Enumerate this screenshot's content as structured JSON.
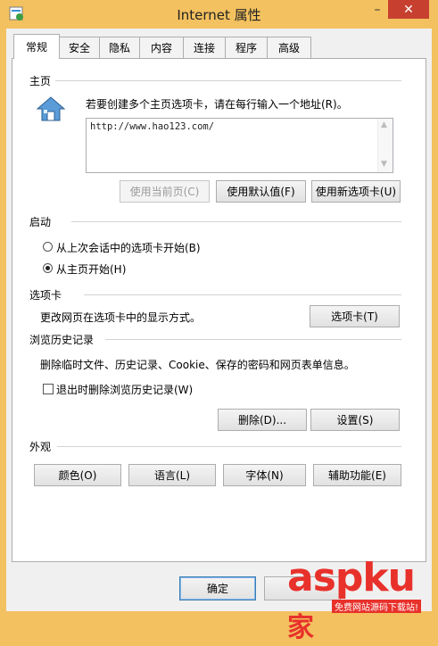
{
  "window": {
    "title": "Internet 属性",
    "minimize_glyph": "–",
    "close_glyph": "✕",
    "accent_color": "#f3c15f",
    "close_color": "#c7402f"
  },
  "tabs": [
    {
      "label": "常规",
      "active": true
    },
    {
      "label": "安全",
      "active": false
    },
    {
      "label": "隐私",
      "active": false
    },
    {
      "label": "内容",
      "active": false
    },
    {
      "label": "连接",
      "active": false
    },
    {
      "label": "程序",
      "active": false
    },
    {
      "label": "高级",
      "active": false
    }
  ],
  "home": {
    "heading": "主页",
    "icon": "house-icon",
    "instruction": "若要创建多个主页选项卡，请在每行输入一个地址(R)。",
    "value": "http://www.hao123.com/",
    "buttons": {
      "use_current": "使用当前页(C)",
      "use_default": "使用默认值(F)",
      "use_new_tab": "使用新选项卡(U)"
    }
  },
  "startup": {
    "heading": "启动",
    "option_last_session": "从上次会话中的选项卡开始(B)",
    "option_home": "从主页开始(H)",
    "selected": "option_home"
  },
  "tabs_section": {
    "heading": "选项卡",
    "description": "更改网页在选项卡中的显示方式。",
    "button": "选项卡(T)"
  },
  "history": {
    "heading": "浏览历史记录",
    "description": "删除临时文件、历史记录、Cookie、保存的密码和网页表单信息。",
    "checkbox_label": "退出时删除浏览历史记录(W)",
    "checked": false,
    "delete_button": "删除(D)...",
    "settings_button": "设置(S)"
  },
  "appearance": {
    "heading": "外观",
    "buttons": {
      "colors": "颜色(O)",
      "languages": "语言(L)",
      "fonts": "字体(N)",
      "accessibility": "辅助功能(E)"
    }
  },
  "footer": {
    "ok_button": "确定"
  },
  "watermark": {
    "text": "aspku",
    "char": "家",
    "subtitle": "免费网站源码下载站!"
  }
}
